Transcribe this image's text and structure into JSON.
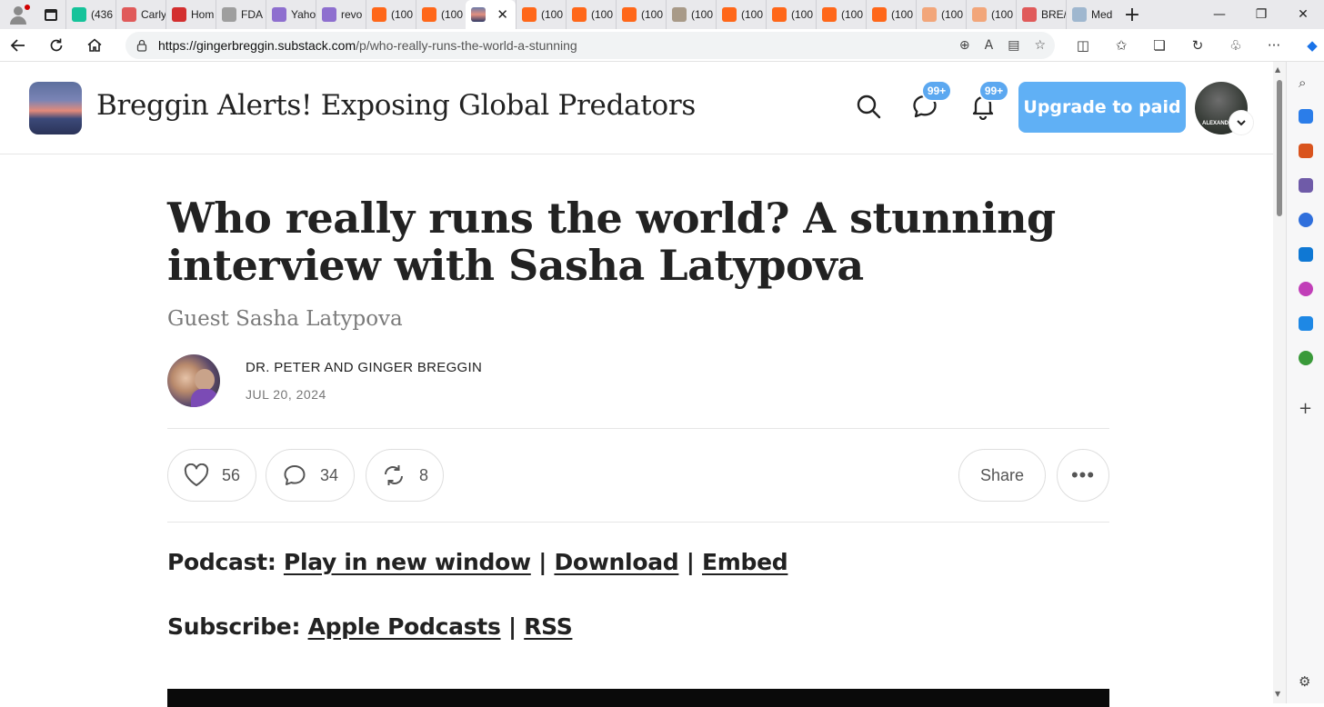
{
  "browser": {
    "tabs": [
      {
        "icon": "grammarly-icon",
        "color": "#15c39a",
        "title": "(436"
      },
      {
        "icon": "youtube-icon",
        "color": "#e05a5a",
        "title": "Carly"
      },
      {
        "icon": "bookmark-icon",
        "color": "#d32f2f",
        "title": "Hom"
      },
      {
        "icon": "document-icon",
        "color": "#9e9e9e",
        "title": "FDA"
      },
      {
        "icon": "yahoo-icon",
        "color": "#8e6fcf",
        "title": "Yaho"
      },
      {
        "icon": "yahoo-icon",
        "color": "#8e6fcf",
        "title": "revo"
      },
      {
        "icon": "substack-icon",
        "color": "#ff6719",
        "title": "(100"
      },
      {
        "icon": "substack-icon",
        "color": "#ff6719",
        "title": "(100"
      }
    ],
    "tabs_after": [
      {
        "icon": "substack-icon",
        "color": "#ff6719",
        "title": "(100"
      },
      {
        "icon": "substack-icon",
        "color": "#ff6719",
        "title": "(100"
      },
      {
        "icon": "substack-icon",
        "color": "#ff6719",
        "title": "(100"
      },
      {
        "icon": "image-icon",
        "color": "#a89a88",
        "title": "(100"
      },
      {
        "icon": "substack-icon",
        "color": "#ff6719",
        "title": "(100"
      },
      {
        "icon": "substack-icon",
        "color": "#ff6719",
        "title": "(100"
      },
      {
        "icon": "substack-icon",
        "color": "#ff6719",
        "title": "(100"
      },
      {
        "icon": "substack-icon",
        "color": "#ff6719",
        "title": "(100"
      },
      {
        "icon": "substack-icon",
        "color": "#f2a67a",
        "title": "(100"
      },
      {
        "icon": "substack-icon",
        "color": "#f2a67a",
        "title": "(100"
      },
      {
        "icon": "youtube-icon",
        "color": "#e05a5a",
        "title": "BRE/"
      },
      {
        "icon": "medical-icon",
        "color": "#9fb7cf",
        "title": "Med"
      }
    ],
    "url_host": "https://gingerbreggin.substack.com",
    "url_path": "/p/who-really-runs-the-world-a-stunning"
  },
  "header": {
    "site_title": "Breggin Alerts! Exposing Global Predators",
    "chat_badge": "99+",
    "notif_badge": "99+",
    "upgrade_label": "Upgrade to paid",
    "avatar_text": "ALEXAND"
  },
  "post": {
    "title": "Who really runs the world? A stunning interview with Sasha Latypova",
    "subtitle": "Guest Sasha Latypova",
    "author": "DR. PETER AND GINGER BREGGIN",
    "date": "JUL 20, 2024",
    "likes": "56",
    "comments": "34",
    "restacks": "8",
    "share_label": "Share",
    "podcast_label": "Podcast:",
    "podcast_links": [
      "Play in new window",
      "Download",
      "Embed"
    ],
    "subscribe_label": "Subscribe:",
    "subscribe_links": [
      "Apple Podcasts",
      "RSS"
    ],
    "separator": "|"
  }
}
